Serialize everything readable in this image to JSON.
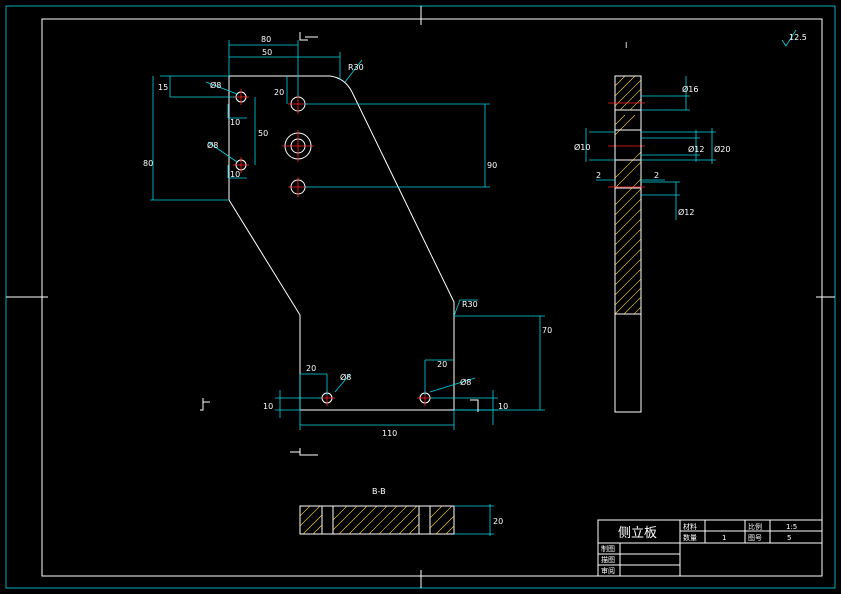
{
  "drawing": {
    "colors": {
      "outline": "#ffffff",
      "dimension": "#00d8e8",
      "centerline": "#ff2020",
      "hatch": "#ffd24a",
      "background": "#000000"
    },
    "dimensions": {
      "d80_top": "80",
      "d50_top": "50",
      "r30": "R30",
      "d15": "15",
      "d20_left": "20",
      "dia8_a": "Ø8",
      "dia8_b": "Ø8",
      "d10_a": "10",
      "d10_b": "10",
      "d50_mid": "50",
      "d80_left": "80",
      "d90_right": "90",
      "r30_lower": "R30",
      "d70": "70",
      "d20_bl": "20",
      "dia8_bl": "Ø8",
      "d20_br": "20",
      "dia8_br": "Ø8",
      "d10_bl": "10",
      "d10_br": "10",
      "d110": "110"
    },
    "side_view": {
      "label": "I",
      "dia16": "Ø16",
      "dia10": "Ø10",
      "dia12_a": "Ø12",
      "dia20": "Ø20",
      "d2_a": "2",
      "d2_b": "2",
      "dia12_b": "Ø12"
    },
    "section_label": "B-B",
    "section_dim": "20",
    "surface_finish": "12.5",
    "title_block": {
      "part_name": "侧立板",
      "material_label": "材料",
      "material_value": "",
      "scale_label": "比例",
      "scale_value": "1:5",
      "qty_label": "数量",
      "qty_value": "1",
      "drawing_no_label": "图号",
      "drawing_no_value": "5",
      "designer_label": "制图",
      "checker_label": "描图",
      "reviewer_label": "审阅"
    }
  }
}
